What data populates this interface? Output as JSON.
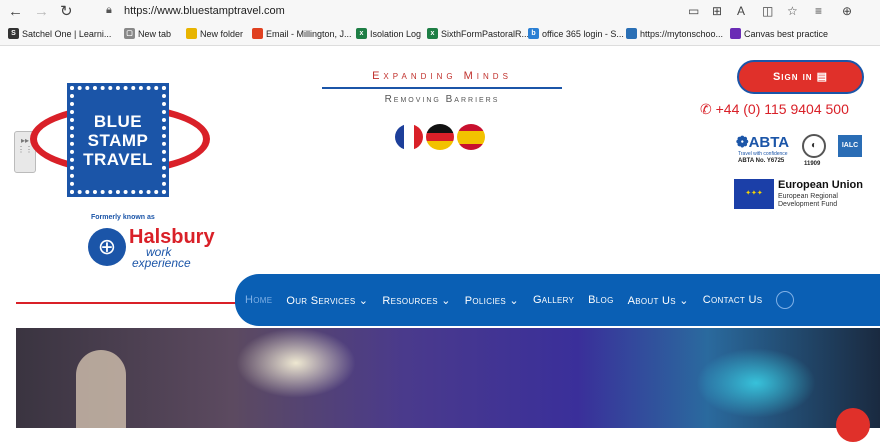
{
  "browser": {
    "url": "https://www.bluestamptravel.com",
    "back": "←",
    "forward": "→",
    "refresh": "↻",
    "bookmarks": [
      {
        "label": "Satchel One | Learni...",
        "icon": "S",
        "color": "#333333"
      },
      {
        "label": "New tab",
        "icon": "▢",
        "color": "#888888"
      },
      {
        "label": "New folder",
        "icon": "▬",
        "color": "#e8b400"
      },
      {
        "label": "Email - Millington, J...",
        "icon": "■",
        "color": "#e04020"
      },
      {
        "label": "Isolation Log",
        "icon": "x",
        "color": "#1e7e45"
      },
      {
        "label": "SixthFormPastoralR...",
        "icon": "x",
        "color": "#1e7e45"
      },
      {
        "label": "office 365 login - S...",
        "icon": "b",
        "color": "#2a7fd4"
      },
      {
        "label": "https://mytonschoo...",
        "icon": "●",
        "color": "#2a6fb5"
      },
      {
        "label": "Canvas best practice",
        "icon": "●",
        "color": "#6a2cb5"
      }
    ]
  },
  "logo": {
    "line1": "BLUE",
    "line2": "STAMP",
    "line3": "TRAVEL",
    "formerly": "Formerly known as",
    "halsbury": "Halsbury",
    "halsbury_sub1": "work",
    "halsbury_sub2": "experience"
  },
  "tagline": {
    "line1": "Expanding Minds",
    "line2": "Removing Barriers"
  },
  "header_right": {
    "signin": "Sign in ▤",
    "phone": "✆ +44 (0) 115 9404 500",
    "abta": "❁ABTA",
    "abta_sub": "Travel with confidence",
    "abta_no": "ABTA No. Y6725",
    "circle_no": "11909",
    "ialc": "IALC",
    "eu_title": "European Union",
    "eu_sub": "European Regional Development Fund"
  },
  "nav": {
    "items": [
      {
        "label": "Home"
      },
      {
        "label": "Our Services ⌄"
      },
      {
        "label": "Resources ⌄"
      },
      {
        "label": "Policies ⌄"
      },
      {
        "label": "Gallery"
      },
      {
        "label": "Blog"
      },
      {
        "label": "About Us ⌄"
      },
      {
        "label": "Contact Us"
      }
    ]
  }
}
